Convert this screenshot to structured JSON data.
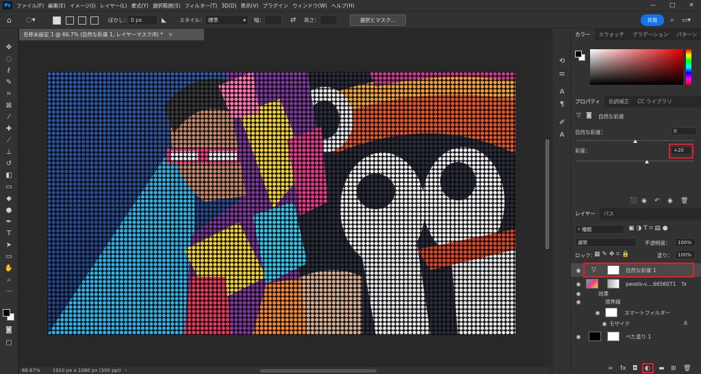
{
  "menubar": {
    "app_logo": "Ps",
    "items": [
      "ファイル(F)",
      "編集(E)",
      "イメージ(I)",
      "レイヤー(L)",
      "書式(Y)",
      "選択範囲(S)",
      "フィルター(T)",
      "3D(D)",
      "表示(V)",
      "プラグイン",
      "ウィンドウ(W)",
      "ヘルプ(H)"
    ],
    "window_controls": [
      "—",
      "□",
      "✕"
    ]
  },
  "options": {
    "feather_label": "ぼかし：",
    "feather_value": "0 px",
    "style_label": "スタイル：",
    "style_value": "標準",
    "width_label": "幅：",
    "height_label": "高さ：",
    "select_mask_button": "選択とマスク...",
    "share_button": "共有"
  },
  "document": {
    "tab_title": "名称未設定 1 @ 66.7% (自然な彩度 1, レイヤーマスク/8) *",
    "zoom": "66.67%",
    "doc_info": "1920 px x 1080 px (300 ppi)"
  },
  "color_panel": {
    "tabs": [
      "カラー",
      "スウォッチ",
      "グラデーション",
      "パターン"
    ],
    "active_tab": 0
  },
  "properties_panel": {
    "tabs": [
      "プロパティ",
      "色調補正",
      "CC ライブラリ"
    ],
    "active_tab": 0,
    "title": "自然な彩度",
    "vibrance_label": "自然な彩度：",
    "vibrance_value": 0,
    "vibrance_display": "0",
    "saturation_label": "彩度：",
    "saturation_value": 20,
    "saturation_display": "+20"
  },
  "layers_panel": {
    "tabs": [
      "レイヤー",
      "パス"
    ],
    "active_tab": 0,
    "filter_kind": "種類",
    "blend_mode": "通常",
    "opacity_label": "不透明度：",
    "opacity_value": "100%",
    "lock_label": "ロック：",
    "fill_label": "塗り：",
    "fill_value": "100%",
    "layers": [
      {
        "name": "自然な彩度 1",
        "selected": true
      },
      {
        "name": "pexels-v....6656071",
        "selected": false
      },
      {
        "name": "効果",
        "selected": false
      },
      {
        "name": "境界線",
        "selected": false
      },
      {
        "name": "スマートフィルター",
        "selected": false
      },
      {
        "name": "モザイク",
        "selected": false
      },
      {
        "name": "べた塗り 1",
        "selected": false
      }
    ],
    "fx_label": "fx"
  }
}
